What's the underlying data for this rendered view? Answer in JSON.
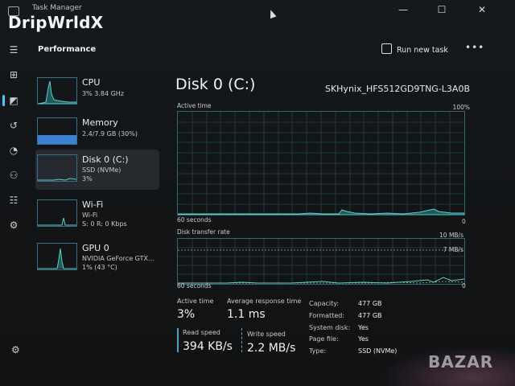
{
  "titlebar": {
    "app_title": "Task Manager",
    "watermark": "DripWrldX",
    "minimize": "—",
    "maximize": "☐",
    "close": "✕"
  },
  "rail": {
    "icons": [
      "menu-icon",
      "processes-icon",
      "performance-icon",
      "app-history-icon",
      "startup-apps-icon",
      "users-icon",
      "details-icon",
      "services-icon"
    ],
    "glyphs": [
      "☰",
      "⊞",
      "◩",
      "↺",
      "◔",
      "⚇",
      "☷",
      "⚙"
    ],
    "settings_glyph": "⚙"
  },
  "header": {
    "title": "Performance",
    "run_new_task": "Run new task",
    "more": "•••"
  },
  "sidebar": {
    "items": [
      {
        "name": "CPU",
        "sub1": "3%  3.84 GHz",
        "sub2": ""
      },
      {
        "name": "Memory",
        "sub1": "2.4/7.9 GB (30%)",
        "sub2": ""
      },
      {
        "name": "Disk 0 (C:)",
        "sub1": "SSD (NVMe)",
        "sub2": "3%"
      },
      {
        "name": "Wi-Fi",
        "sub1": "Wi-Fi",
        "sub2": "S: 0 R: 0 Kbps"
      },
      {
        "name": "GPU 0",
        "sub1": "NVIDIA GeForce GTX...",
        "sub2": "1% (43 °C)"
      }
    ],
    "active_index": 2
  },
  "disk": {
    "title": "Disk 0 (C:)",
    "model": "SKHynix_HFS512GD9TNG-L3A0B",
    "active_time_label": "Active time",
    "active_time_max": "100%",
    "active_time_xlabel": "60 seconds",
    "active_time_xmin": "0",
    "transfer_label": "Disk transfer rate",
    "transfer_max": "10 MB/s",
    "transfer_mid": "7 MB/s",
    "transfer_xlabel": "60 seconds",
    "transfer_xmin": "0"
  },
  "stats": {
    "active_time_label": "Active time",
    "active_time_value": "3%",
    "avg_response_label": "Average response time",
    "avg_response_value": "1.1 ms",
    "read_speed_label": "Read speed",
    "read_speed_value": "394 KB/s",
    "write_speed_label": "Write speed",
    "write_speed_value": "2.2 MB/s"
  },
  "details": [
    {
      "key": "Capacity:",
      "value": "477 GB"
    },
    {
      "key": "Formatted:",
      "value": "477 GB"
    },
    {
      "key": "System disk:",
      "value": "Yes"
    },
    {
      "key": "Page file:",
      "value": "Yes"
    },
    {
      "key": "Type:",
      "value": "SSD (NVMe)"
    }
  ],
  "overlay": {
    "bazar_logo": "BAZAR"
  },
  "colors": {
    "accent": "#4cc2ff",
    "graph_line": "#5fd0c8",
    "graph_fill": "#1f5a5a",
    "memory_fill": "#3d7fd0"
  }
}
